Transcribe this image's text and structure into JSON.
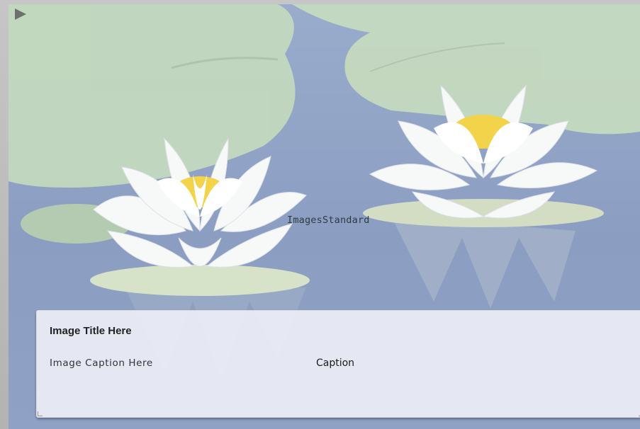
{
  "stage": {
    "overlay_label": "ImagesStandard"
  },
  "caption_panel": {
    "title": "Image Title Here",
    "caption_text": "Image Caption Here",
    "caption_field_label": "Caption"
  },
  "controls": {
    "play_icon": "play-icon"
  },
  "colors": {
    "water": "#8b9ec2",
    "lily_pad": "#c9ddc0",
    "panel": "#eceef6",
    "flower_center": "#f3d34a"
  }
}
